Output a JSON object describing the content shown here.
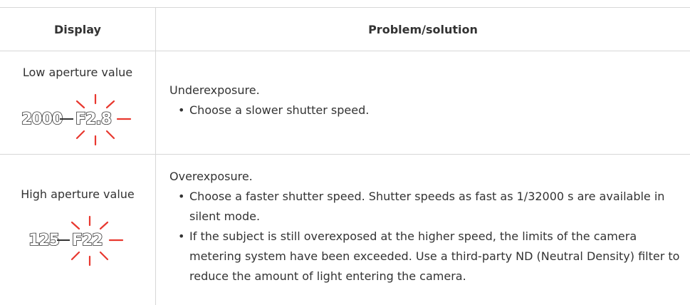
{
  "table": {
    "header": {
      "display": "Display",
      "problem": "Problem/solution"
    },
    "rows": [
      {
        "display_label": "Low aperture value",
        "lcd_shutter": "2000",
        "lcd_aperture": "F2.8",
        "problem": "Underexposure.",
        "solutions": [
          "Choose a slower shutter speed."
        ]
      },
      {
        "display_label": "High aperture value",
        "lcd_shutter": "125",
        "lcd_aperture": "F22",
        "problem": "Overexposure.",
        "solutions": [
          "Choose a faster shutter speed. Shutter speeds as fast as 1/32000 s are available in silent mode.",
          "If the subject is still overexposed at the higher speed, the limits of the camera metering system have been exceeded. Use a third-party ND (Neutral Density) filter to reduce the amount of light entering the camera."
        ]
      }
    ]
  },
  "colors": {
    "flash": "#e8382f",
    "border": "#d7d7d7",
    "text": "#333333"
  }
}
